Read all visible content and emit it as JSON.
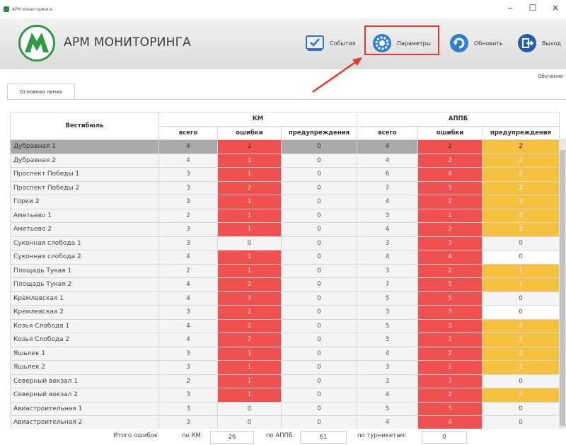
{
  "window": {
    "title": "АРМ мониторинга",
    "minimize": "–",
    "maximize": "☐",
    "close": "×"
  },
  "header": {
    "app_title": "АРМ МОНИТОРИНГА",
    "buttons": {
      "events": "События",
      "params": "Параметры",
      "refresh": "Обновить",
      "exit": "Выход"
    }
  },
  "user_label": "Обучение",
  "tab": "Основная линия",
  "table": {
    "col_station": "Вестибюль",
    "group_km": "КМ",
    "group_appb": "АППБ",
    "sub": {
      "total": "всего",
      "errors": "ошибки",
      "warnings": "предупреждения"
    },
    "rows": [
      {
        "name": "Дубравная 1",
        "km": [
          "4",
          "2",
          "0"
        ],
        "ap": [
          "4",
          "2",
          "2"
        ],
        "km_c": [
          "",
          "red",
          ""
        ],
        "ap_c": [
          "",
          "red",
          "yellow"
        ],
        "sel": true
      },
      {
        "name": "Дубравная 2",
        "km": [
          "4",
          "1",
          "0"
        ],
        "ap": [
          "4",
          "2",
          "2"
        ],
        "km_c": [
          "",
          "red",
          ""
        ],
        "ap_c": [
          "",
          "red",
          "yellow"
        ]
      },
      {
        "name": "Проспект Победы 1",
        "km": [
          "3",
          "1",
          "0"
        ],
        "ap": [
          "6",
          "4",
          "2"
        ],
        "km_c": [
          "",
          "red",
          ""
        ],
        "ap_c": [
          "",
          "red",
          "yellow"
        ]
      },
      {
        "name": "Проспект Победы 2",
        "km": [
          "3",
          "2",
          "0"
        ],
        "ap": [
          "7",
          "5",
          "2"
        ],
        "km_c": [
          "",
          "red",
          ""
        ],
        "ap_c": [
          "",
          "red",
          "yellow"
        ]
      },
      {
        "name": "Горки 2",
        "km": [
          "3",
          "1",
          "0"
        ],
        "ap": [
          "4",
          "2",
          "2"
        ],
        "km_c": [
          "",
          "red",
          ""
        ],
        "ap_c": [
          "",
          "red",
          "yellow"
        ]
      },
      {
        "name": "Аметьево 1",
        "km": [
          "2",
          "1",
          "0"
        ],
        "ap": [
          "3",
          "1",
          "2"
        ],
        "km_c": [
          "",
          "red",
          ""
        ],
        "ap_c": [
          "",
          "red",
          "yellow"
        ]
      },
      {
        "name": "Аметьево 2",
        "km": [
          "3",
          "1",
          "0"
        ],
        "ap": [
          "4",
          "2",
          "2"
        ],
        "km_c": [
          "",
          "red",
          ""
        ],
        "ap_c": [
          "",
          "red",
          "yellow"
        ]
      },
      {
        "name": "Суконная слобода 1",
        "km": [
          "3",
          "0",
          "0"
        ],
        "ap": [
          "3",
          "3",
          "0"
        ],
        "km_c": [
          "",
          "",
          ""
        ],
        "ap_c": [
          "",
          "red",
          ""
        ]
      },
      {
        "name": "Суконная слобода 2",
        "km": [
          "4",
          "1",
          "0"
        ],
        "ap": [
          "4",
          "4",
          "0"
        ],
        "km_c": [
          "",
          "red",
          ""
        ],
        "ap_c": [
          "",
          "red",
          "white"
        ]
      },
      {
        "name": "Площадь Тукая 1",
        "km": [
          "2",
          "1",
          "0"
        ],
        "ap": [
          "3",
          "2",
          "1"
        ],
        "km_c": [
          "",
          "red",
          ""
        ],
        "ap_c": [
          "",
          "red",
          "yellow"
        ]
      },
      {
        "name": "Площадь Тукая 2",
        "km": [
          "4",
          "2",
          "0"
        ],
        "ap": [
          "7",
          "5",
          "1"
        ],
        "km_c": [
          "",
          "red",
          ""
        ],
        "ap_c": [
          "",
          "red",
          "yellow"
        ]
      },
      {
        "name": "Кремлевская 1",
        "km": [
          "4",
          "3",
          "0"
        ],
        "ap": [
          "5",
          "5",
          "0"
        ],
        "km_c": [
          "",
          "red",
          ""
        ],
        "ap_c": [
          "",
          "red",
          ""
        ]
      },
      {
        "name": "Кремлевская 2",
        "km": [
          "3",
          "2",
          "0"
        ],
        "ap": [
          "3",
          "3",
          "0"
        ],
        "km_c": [
          "",
          "red",
          ""
        ],
        "ap_c": [
          "",
          "red",
          "white"
        ]
      },
      {
        "name": "Козья Слобода 1",
        "km": [
          "4",
          "2",
          "0"
        ],
        "ap": [
          "5",
          "3",
          "2"
        ],
        "km_c": [
          "",
          "red",
          ""
        ],
        "ap_c": [
          "",
          "red",
          "yellow"
        ]
      },
      {
        "name": "Козья Слобода 2",
        "km": [
          "4",
          "2",
          "0"
        ],
        "ap": [
          "3",
          "1",
          "2"
        ],
        "km_c": [
          "",
          "red",
          ""
        ],
        "ap_c": [
          "",
          "red",
          "yellow"
        ]
      },
      {
        "name": "Яшьлек 1",
        "km": [
          "3",
          "1",
          "0"
        ],
        "ap": [
          "4",
          "2",
          "2"
        ],
        "km_c": [
          "",
          "red",
          ""
        ],
        "ap_c": [
          "",
          "red",
          "yellow"
        ]
      },
      {
        "name": "Яшьлек 2",
        "km": [
          "3",
          "1",
          "0"
        ],
        "ap": [
          "3",
          "1",
          "2"
        ],
        "km_c": [
          "",
          "red",
          ""
        ],
        "ap_c": [
          "",
          "red",
          "yellow"
        ]
      },
      {
        "name": "Северный вокзал 1",
        "km": [
          "2",
          "1",
          "0"
        ],
        "ap": [
          "3",
          "3",
          "0"
        ],
        "km_c": [
          "",
          "red",
          ""
        ],
        "ap_c": [
          "",
          "red",
          ""
        ]
      },
      {
        "name": "Северный вокзал 2",
        "km": [
          "3",
          "1",
          "0"
        ],
        "ap": [
          "4",
          "2",
          "2"
        ],
        "km_c": [
          "",
          "red",
          ""
        ],
        "ap_c": [
          "",
          "red",
          "yellow"
        ]
      },
      {
        "name": "Авиастроительная 1",
        "km": [
          "3",
          "0",
          "0"
        ],
        "ap": [
          "5",
          "5",
          "0"
        ],
        "km_c": [
          "",
          "",
          ""
        ],
        "ap_c": [
          "",
          "red",
          ""
        ]
      },
      {
        "name": "Авиастроительная 2",
        "km": [
          "3",
          "0",
          "0"
        ],
        "ap": [
          "4",
          "4",
          "0"
        ],
        "km_c": [
          "",
          "",
          ""
        ],
        "ap_c": [
          "",
          "red",
          ""
        ]
      }
    ]
  },
  "footer": {
    "total_label": "Итого ошибок",
    "km_label": "по КМ:",
    "km_value": "26",
    "appb_label": "по АППБ:",
    "appb_value": "61",
    "turnstile_label": "по турникетам:",
    "turnstile_value": "0"
  },
  "colors": {
    "error": "#f0504f",
    "warning": "#f6c13e",
    "selected_row": "#a9a9a9",
    "highlight_frame": "#e53935",
    "logo_green": "#2e9a46"
  }
}
